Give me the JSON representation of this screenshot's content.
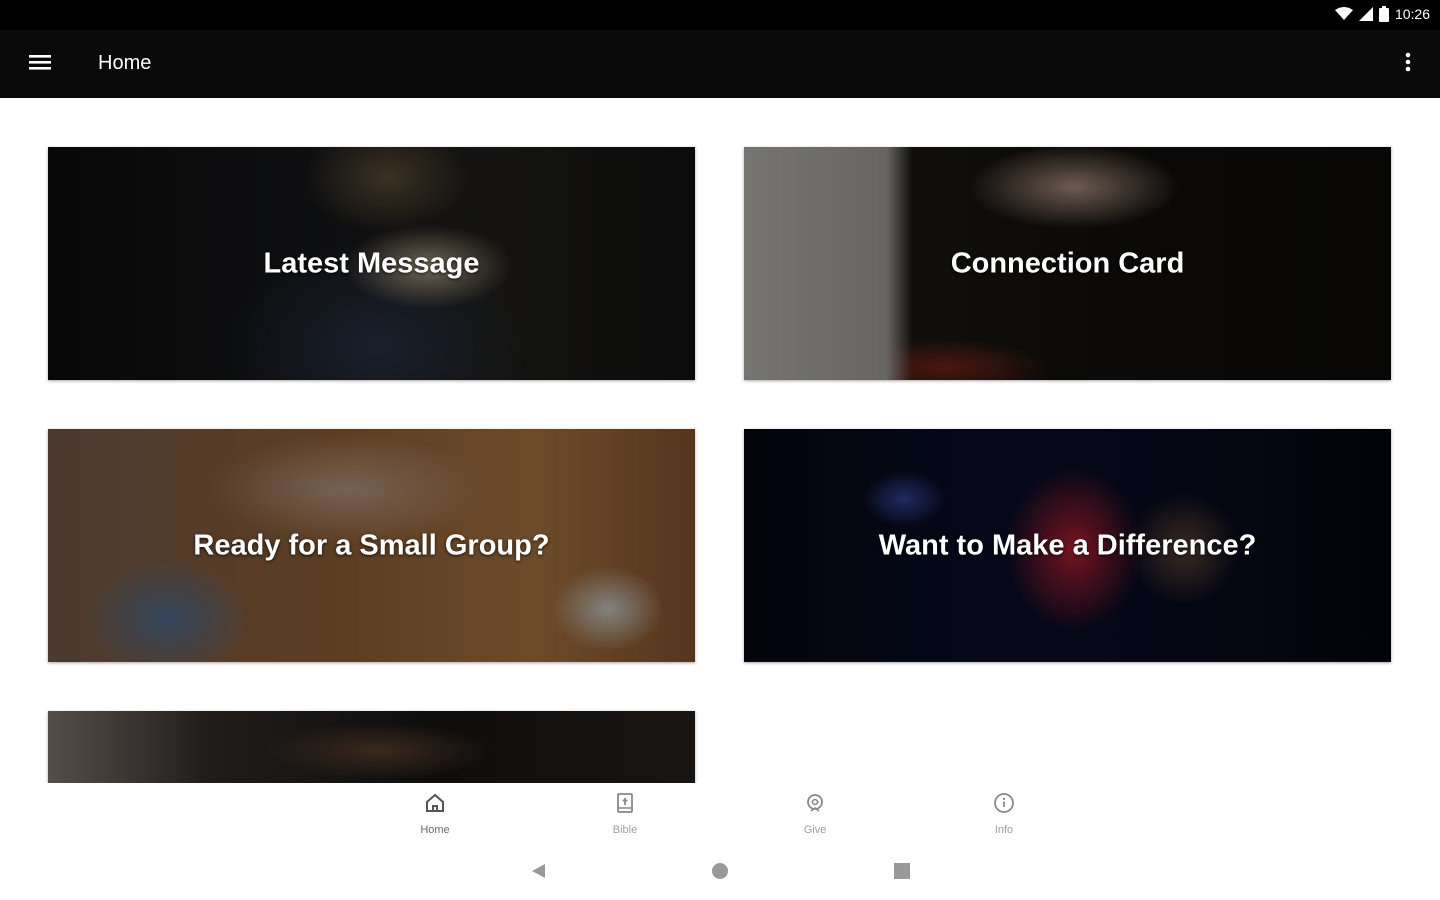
{
  "status_bar": {
    "time": "10:26"
  },
  "app_bar": {
    "title": "Home"
  },
  "cards": [
    {
      "title": "Latest Message"
    },
    {
      "title": "Connection Card"
    },
    {
      "title": "Ready for a Small Group?"
    },
    {
      "title": "Want to Make a Difference?"
    },
    {
      "title": ""
    }
  ],
  "bottom_nav": {
    "items": [
      {
        "label": "Home",
        "icon": "home-icon",
        "active": true
      },
      {
        "label": "Bible",
        "icon": "bible-icon",
        "active": false
      },
      {
        "label": "Give",
        "icon": "give-icon",
        "active": false
      },
      {
        "label": "Info",
        "icon": "info-icon",
        "active": false
      }
    ]
  },
  "colors": {
    "app_bar": "#0a0a0a",
    "nav_label": "#9e9e9e",
    "background": "#ffffff"
  }
}
